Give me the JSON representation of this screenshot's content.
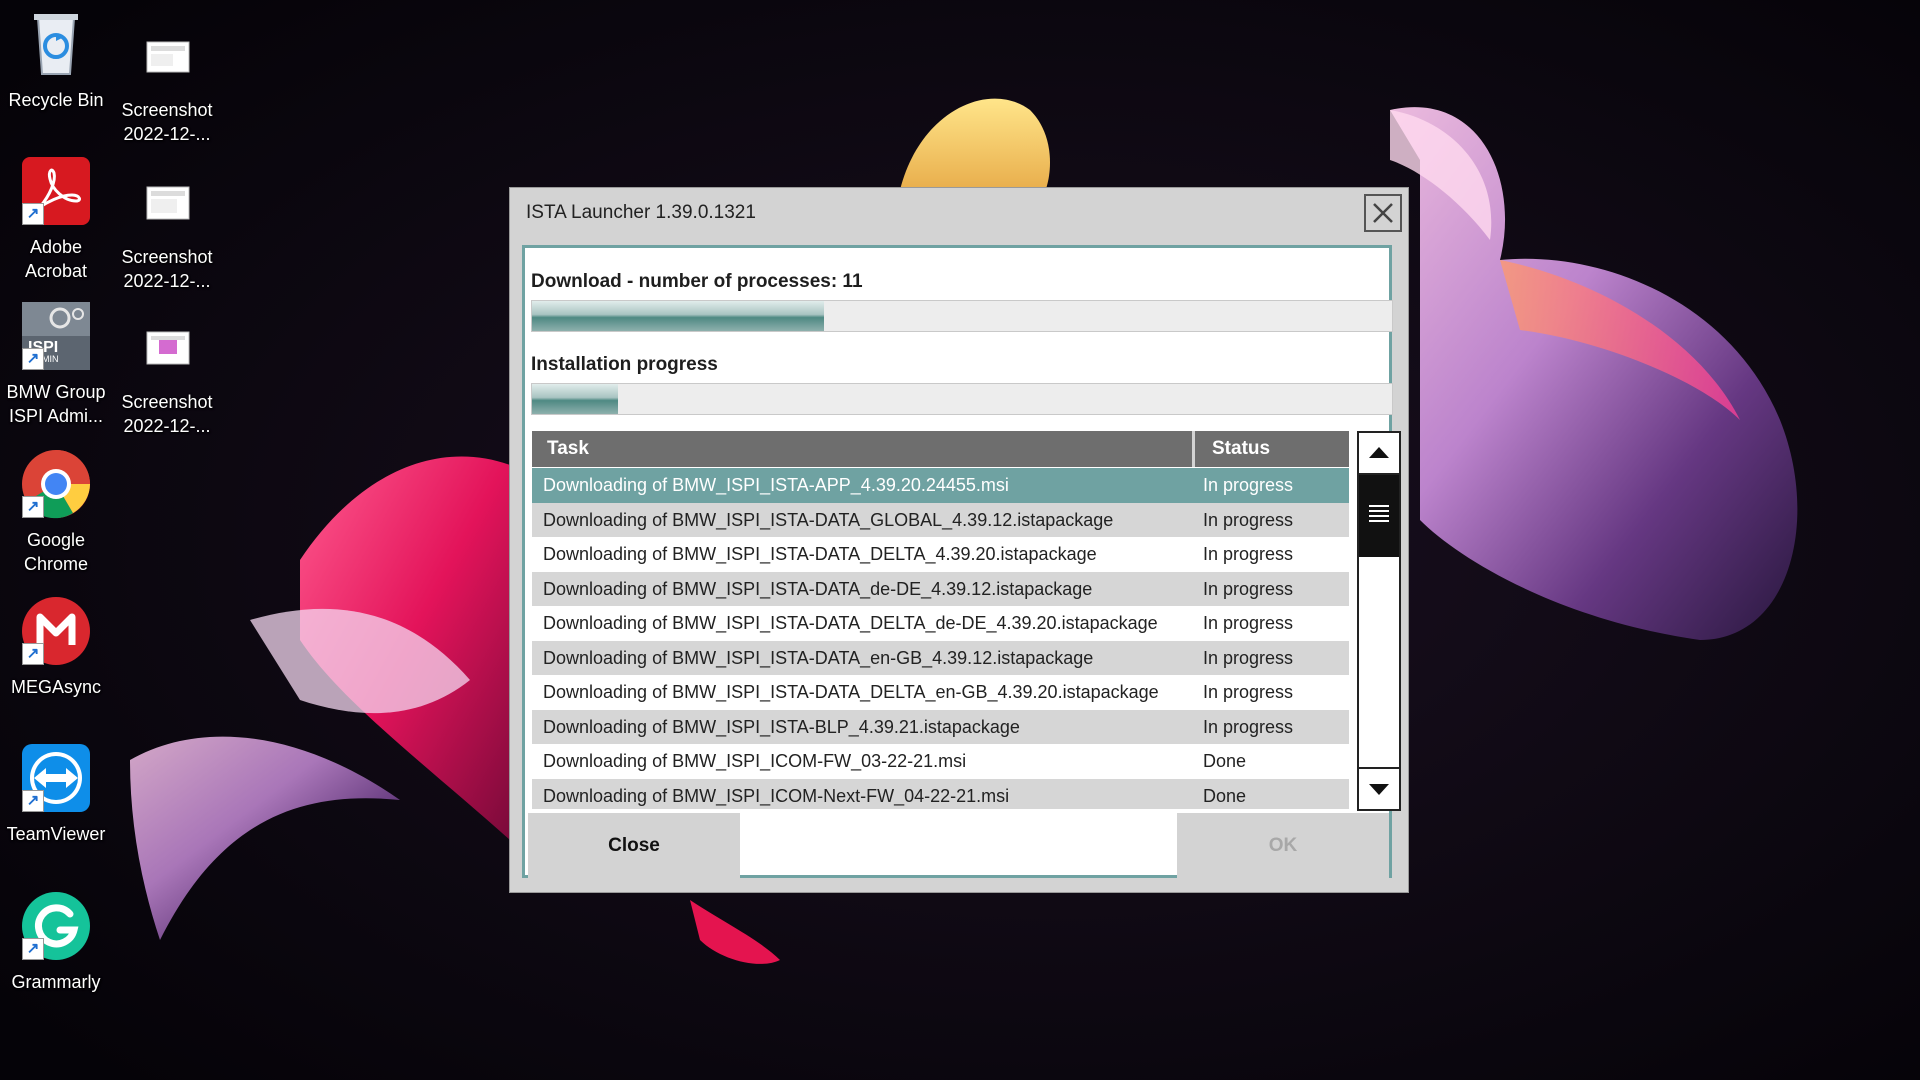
{
  "desktop": {
    "icons": [
      {
        "label": "Recycle Bin"
      },
      {
        "label": "Screenshot\n2022-12-..."
      },
      {
        "label": "Adobe\nAcrobat"
      },
      {
        "label": "Screenshot\n2022-12-..."
      },
      {
        "label": "BMW Group\nISPI Admi..."
      },
      {
        "label": "Screenshot\n2022-12-..."
      },
      {
        "label": "Google\nChrome"
      },
      {
        "label": "MEGAsync"
      },
      {
        "label": "TeamViewer"
      },
      {
        "label": "Grammarly"
      }
    ],
    "ispi_badge": "ISPI",
    "ispi_badge_sub": "MIN"
  },
  "dialog": {
    "title": "ISTA Launcher 1.39.0.1321",
    "download_label": "Download - number of processes: 11",
    "download_progress": 0.34,
    "install_label": "Installation progress",
    "install_progress": 0.1,
    "table": {
      "columns": [
        "Task",
        "Status"
      ],
      "rows": [
        {
          "task": "Downloading of BMW_ISPI_ISTA-APP_4.39.20.24455.msi",
          "status": "In progress",
          "selected": true
        },
        {
          "task": "Downloading of BMW_ISPI_ISTA-DATA_GLOBAL_4.39.12.istapackage",
          "status": "In progress"
        },
        {
          "task": "Downloading of BMW_ISPI_ISTA-DATA_DELTA_4.39.20.istapackage",
          "status": "In progress"
        },
        {
          "task": "Downloading of BMW_ISPI_ISTA-DATA_de-DE_4.39.12.istapackage",
          "status": "In progress"
        },
        {
          "task": "Downloading of BMW_ISPI_ISTA-DATA_DELTA_de-DE_4.39.20.istapackage",
          "status": "In progress"
        },
        {
          "task": "Downloading of BMW_ISPI_ISTA-DATA_en-GB_4.39.12.istapackage",
          "status": "In progress"
        },
        {
          "task": "Downloading of BMW_ISPI_ISTA-DATA_DELTA_en-GB_4.39.20.istapackage",
          "status": "In progress"
        },
        {
          "task": "Downloading of BMW_ISPI_ISTA-BLP_4.39.21.istapackage",
          "status": "In progress"
        },
        {
          "task": "Downloading of BMW_ISPI_ICOM-FW_03-22-21.msi",
          "status": "Done"
        },
        {
          "task": "Downloading of BMW_ISPI_ICOM-Next-FW_04-22-21.msi",
          "status": "Done"
        }
      ]
    },
    "buttons": {
      "close": "Close",
      "ok": "OK"
    }
  },
  "colors": {
    "accent": "#6fa2a2",
    "header": "#6e6e6e",
    "dialog_bg": "#d3d3d3"
  }
}
